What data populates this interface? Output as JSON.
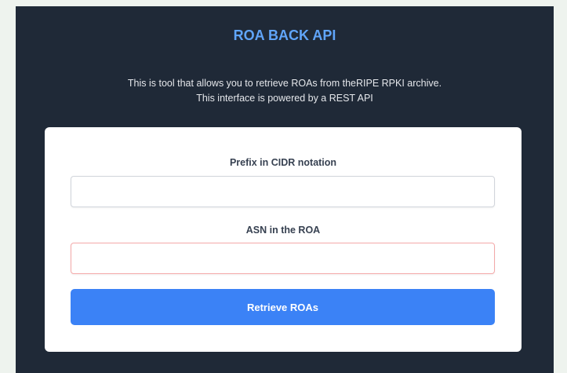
{
  "header": {
    "title": "ROA BACK API",
    "description_line1": "This is tool that allows you to retrieve ROAs from theRIPE RPKI archive.",
    "description_line2": "This interface is powered by a REST API"
  },
  "form": {
    "prefix_label": "Prefix in CIDR notation",
    "prefix_value": "",
    "asn_label": "ASN in the ROA",
    "asn_value": "",
    "submit_label": "Retrieve ROAs"
  },
  "colors": {
    "page_background": "#eef3ee",
    "panel_background": "#1f2937",
    "title": "#60a5fa",
    "button": "#3b82f6",
    "error_border": "#f4a9a9"
  }
}
